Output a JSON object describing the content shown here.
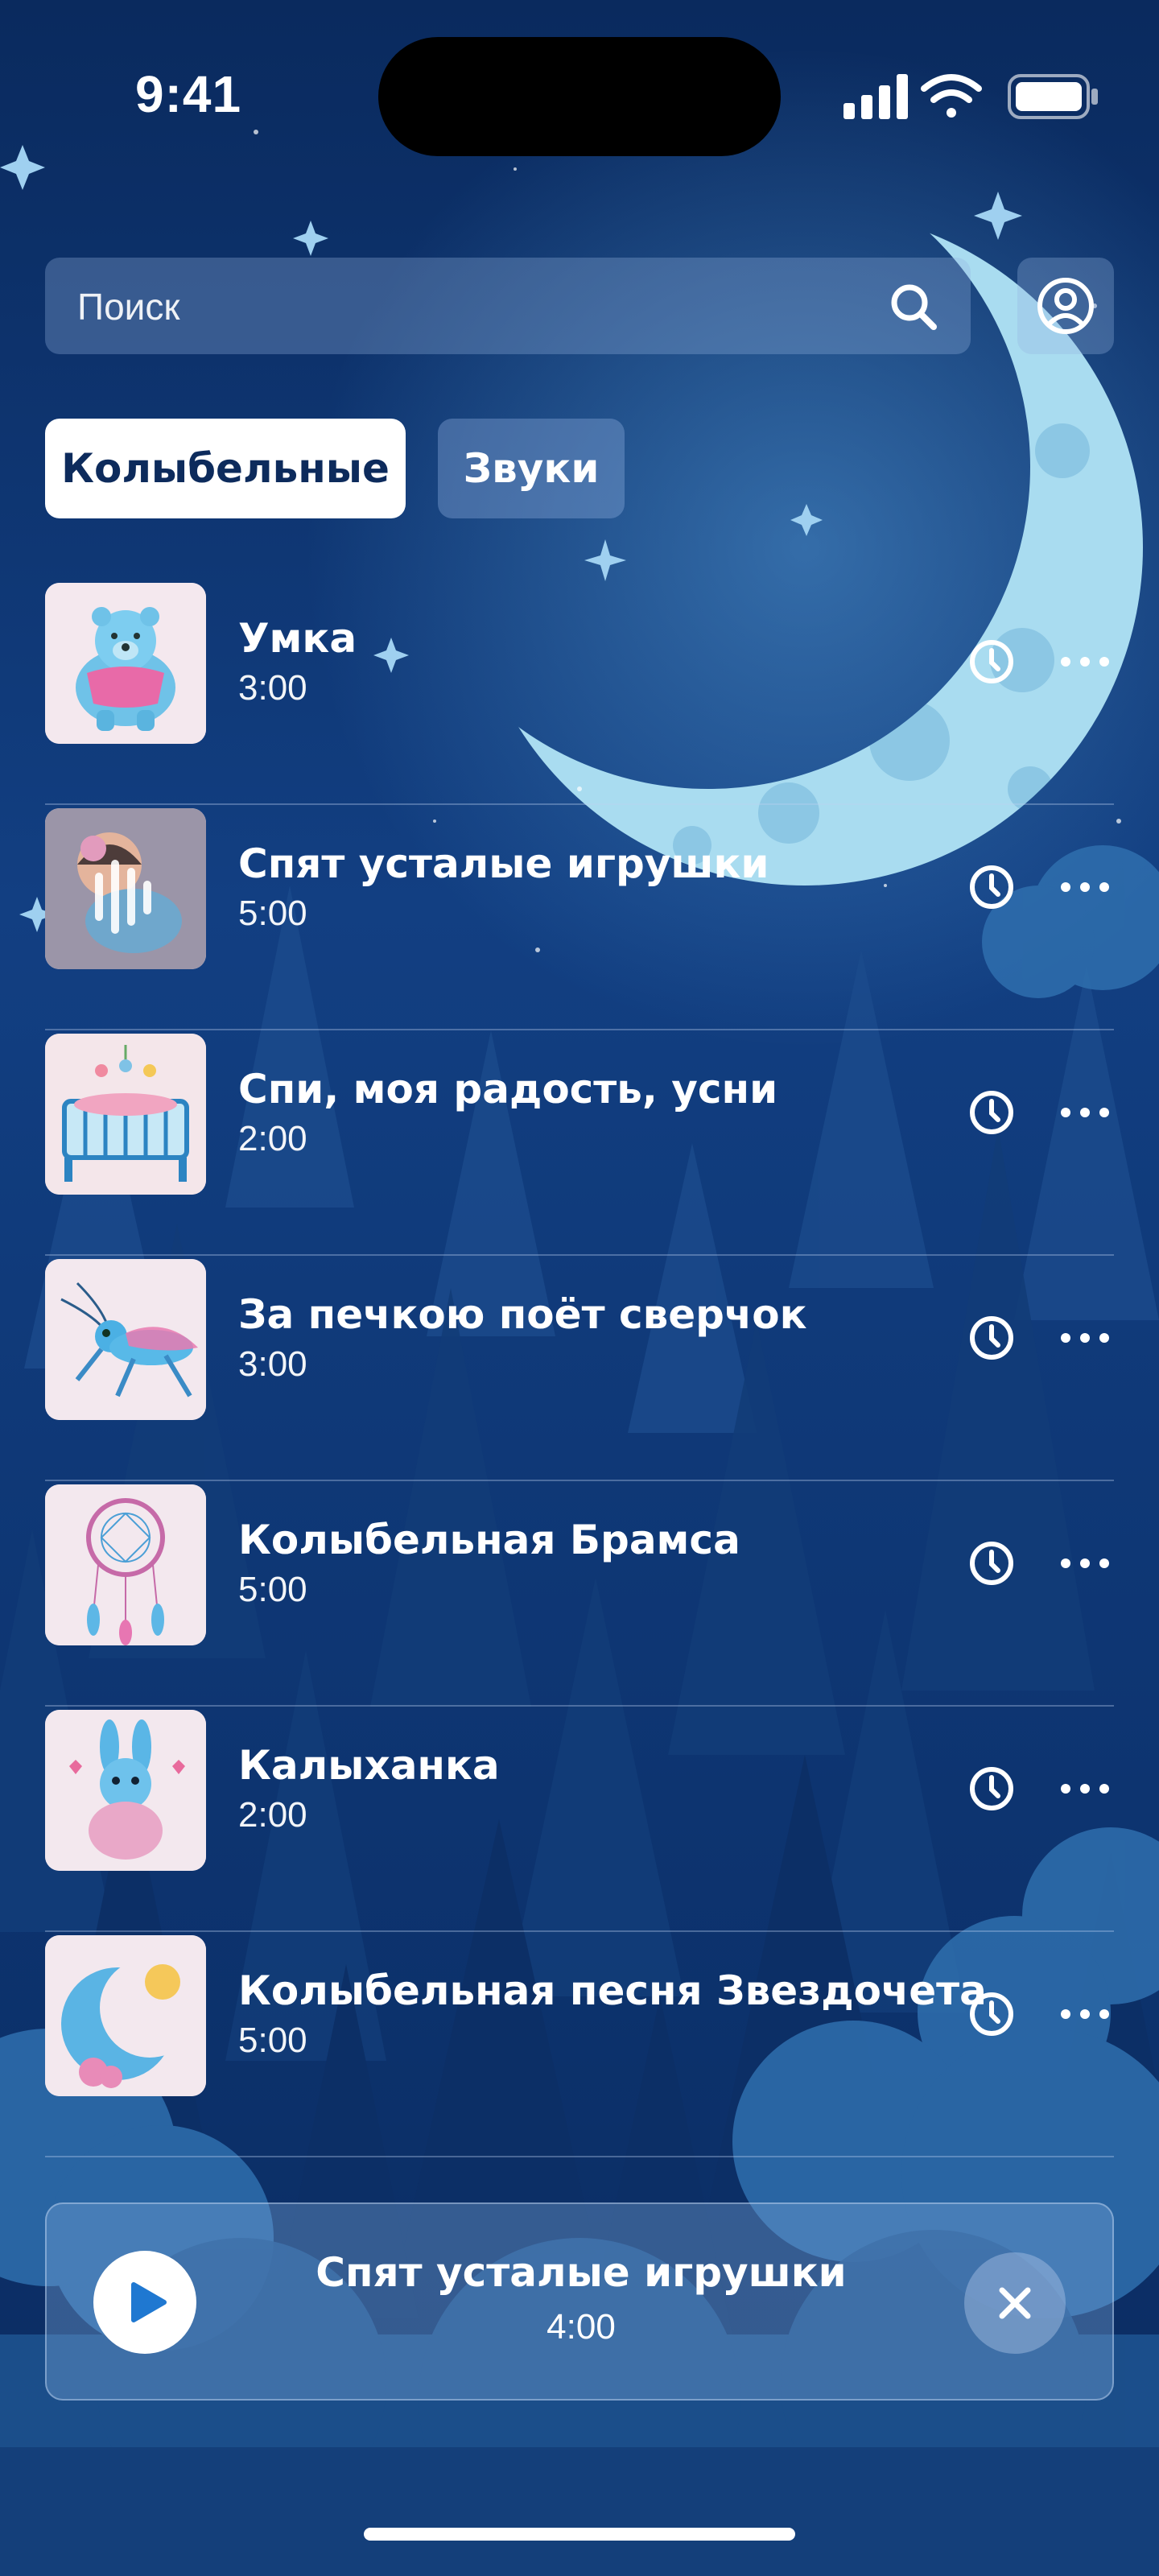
{
  "status_bar": {
    "time": "9:41"
  },
  "search": {
    "placeholder": "Поиск"
  },
  "tabs": [
    {
      "label": "Колыбельные",
      "active": true
    },
    {
      "label": "Звуки",
      "active": false
    }
  ],
  "items": [
    {
      "title": "Умка",
      "duration": "3:00",
      "thumb": "polar-bear"
    },
    {
      "title": "Спят усталые игрушки",
      "duration": "5:00",
      "thumb": "sleeping-doll",
      "playing": true
    },
    {
      "title": "Спи, моя радость, усни",
      "duration": "2:00",
      "thumb": "crib"
    },
    {
      "title": "За печкою поёт сверчок",
      "duration": "3:00",
      "thumb": "cricket"
    },
    {
      "title": "Колыбельная Брамса",
      "duration": "5:00",
      "thumb": "dreamcatcher"
    },
    {
      "title": "Калыханка",
      "duration": "2:00",
      "thumb": "bunny"
    },
    {
      "title": "Колыбельная песня Звездочета",
      "duration": "5:00",
      "thumb": "moon-and-sun"
    }
  ],
  "player": {
    "title": "Спят усталые игрушки",
    "duration": "4:00"
  },
  "colors": {
    "background": "#0b2d63",
    "accent": "#1f78d1",
    "moon": "#a9dcf0"
  }
}
